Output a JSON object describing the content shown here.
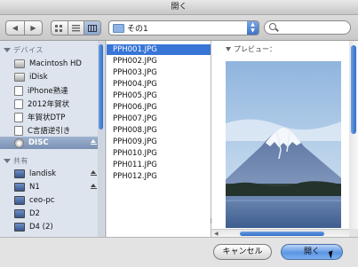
{
  "window": {
    "title": "開く"
  },
  "toolbar": {
    "back_label": "◀",
    "forward_label": "▶",
    "view_icons": [
      "icon-view-icon",
      "list-view-icon",
      "column-view-icon"
    ],
    "location": "その1",
    "search_placeholder": ""
  },
  "sidebar": {
    "devices_header": "デバイス",
    "devices": [
      {
        "label": "Macintosh HD",
        "icon": "hard-disk-icon"
      },
      {
        "label": "iDisk",
        "icon": "idisk-icon"
      },
      {
        "label": "iPhone熟達",
        "icon": "document-icon"
      },
      {
        "label": "2012年賀状",
        "icon": "document-icon"
      },
      {
        "label": "年賀状DTP",
        "icon": "document-icon"
      },
      {
        "label": "C言語逆引き",
        "icon": "document-icon"
      },
      {
        "label": "DISC",
        "icon": "disc-icon",
        "selected": true
      }
    ],
    "shared_header": "共有",
    "shared": [
      {
        "label": "landisk",
        "icon": "network-monitor-icon"
      },
      {
        "label": "N1",
        "icon": "network-monitor-icon"
      },
      {
        "label": "ceo-pc",
        "icon": "network-monitor-icon"
      },
      {
        "label": "D2",
        "icon": "network-monitor-icon"
      },
      {
        "label": "D4 (2)",
        "icon": "network-monitor-icon"
      }
    ]
  },
  "files": [
    "PPH001.JPG",
    "PPH002.JPG",
    "PPH003.JPG",
    "PPH004.JPG",
    "PPH005.JPG",
    "PPH006.JPG",
    "PPH007.JPG",
    "PPH008.JPG",
    "PPH009.JPG",
    "PPH010.JPG",
    "PPH011.JPG",
    "PPH012.JPG"
  ],
  "selected_file_index": 0,
  "preview": {
    "label": "プレビュー："
  },
  "buttons": {
    "cancel": "キャンセル",
    "open": "開く"
  },
  "colors": {
    "selection": "#3875d7",
    "accent": "#5b95e3",
    "sidebar_bg": "#dde4ee"
  }
}
